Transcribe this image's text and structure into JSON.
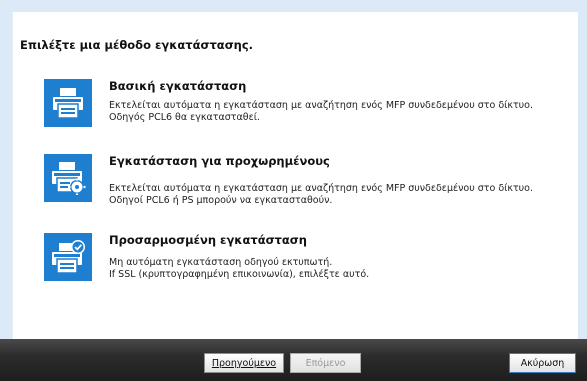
{
  "heading": "Επιλέξτε μια μέθοδο εγκατάστασης.",
  "options": [
    {
      "title": "Βασική εγκατάσταση",
      "desc1": "Εκτελείται αυτόματα η εγκατάσταση με αναζήτηση ενός MFP συνδεδεμένου στο δίκτυο.",
      "desc2": "Οδηγός PCL6 θα εγκατασταθεί.",
      "icon": "printer-icon"
    },
    {
      "title": "Εγκατάσταση για προχωρημένους",
      "desc1": "Εκτελείται αυτόματα η εγκατάσταση με αναζήτηση ενός MFP συνδεδεμένου στο δίκτυο.",
      "desc2": "Οδηγοί PCL6 ή PS μπορούν να εγκατασταθούν.",
      "icon": "printer-gear-icon"
    },
    {
      "title": "Προσαρμοσμένη εγκατάσταση",
      "desc1": "Μη αυτόματη εγκατάσταση οδηγού εκτυπωτή.",
      "desc2": "If SSL (κρυπτογραφημένη επικοινωνία), επιλέξτε αυτό.",
      "icon": "printer-check-icon"
    }
  ],
  "buttons": {
    "back": "Προηγούμενο",
    "next": "Επόμενο",
    "cancel": "Ακύρωση"
  },
  "colors": {
    "tile": "#1e7fd0",
    "frame": "#dce9f7"
  }
}
